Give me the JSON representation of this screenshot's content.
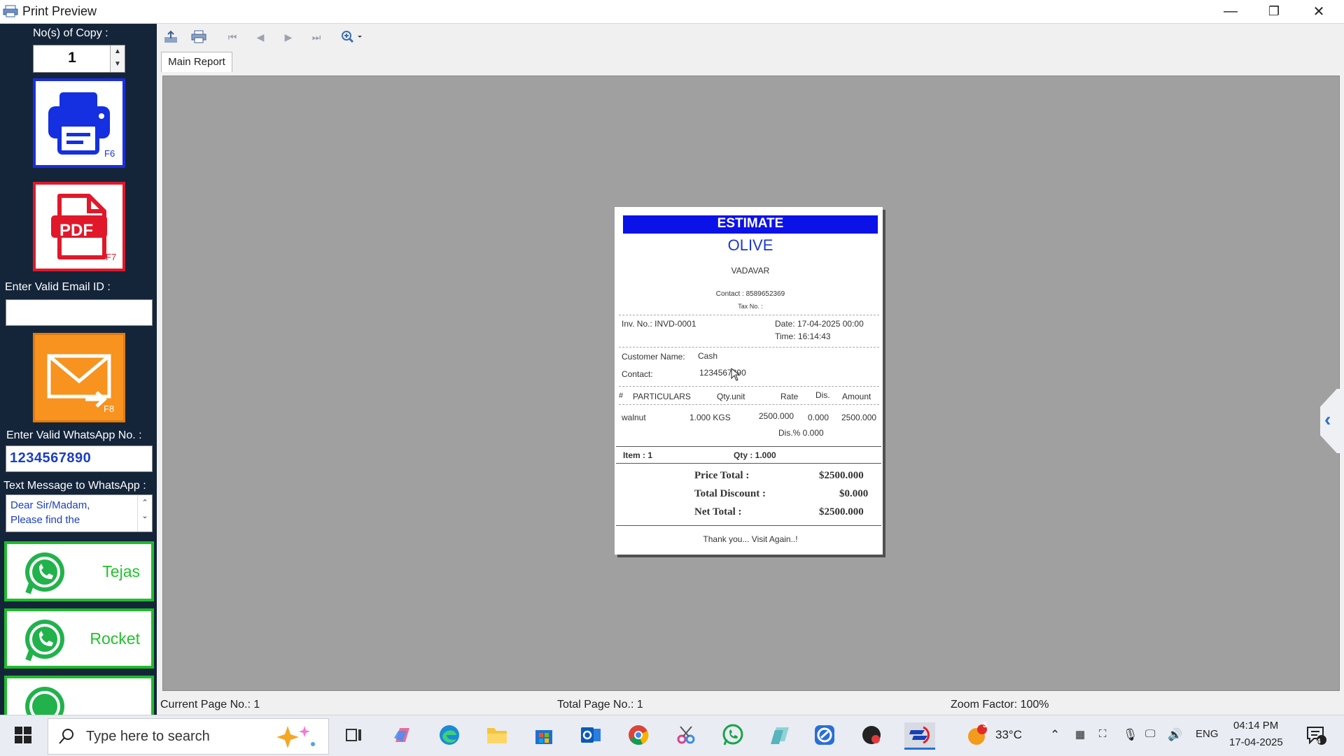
{
  "window": {
    "title": "Print Preview",
    "minimize": "—",
    "restore": "❐",
    "close": "✕"
  },
  "sidebar": {
    "copies_label": "No(s) of Copy :",
    "copies_value": "1",
    "print_key": "F6",
    "pdf_text": "PDF",
    "pdf_key": "F7",
    "email_label": "Enter Valid Email ID :",
    "email_value": "",
    "email_key": "F8",
    "whatsapp_label": "Enter Valid WhatsApp No. :",
    "whatsapp_value": "1234567890",
    "message_label": "Text Message to WhatsApp :",
    "message_line1": "Dear Sir/Madam,",
    "message_line2": "Please find the",
    "whatsapp_buttons": [
      {
        "label": "Tejas"
      },
      {
        "label": "Rocket"
      }
    ]
  },
  "toolbar": {
    "tab": "Main Report"
  },
  "report": {
    "header": "ESTIMATE",
    "company": "OLIVE",
    "address": "VADAVAR",
    "contact": "Contact : 8589652369",
    "tax": "Tax No. :",
    "inv_no": "Inv. No.:  INVD-0001",
    "date": "Date: 17-04-2025 00:00",
    "time": "Time: 16:14:43",
    "customer_label": "Customer Name:",
    "customer_value": "Cash",
    "contact_label": "Contact:",
    "contact_value": "1234567890",
    "columns": {
      "no": "#",
      "particulars": "PARTICULARS",
      "qty": "Qty.unit",
      "rate": "Rate",
      "dis": "Dis.",
      "amount": "Amount"
    },
    "items": [
      {
        "name": "walnut",
        "qty": "1.000 KGS",
        "rate": "2500.000",
        "dis": "0.000",
        "amount": "2500.000",
        "dis_pct": "Dis.% 0.000"
      }
    ],
    "item_count": "Item : 1",
    "qty_total": "Qty : 1.000",
    "price_total_label": "Price Total :",
    "price_total": "$2500.000",
    "discount_label": "Total Discount :",
    "discount": "$0.000",
    "net_label": "Net Total :",
    "net": "$2500.000",
    "footer": "Thank you... Visit Again..!"
  },
  "status": {
    "current_page": "Current Page No.: 1",
    "total_page": "Total Page No.: 1",
    "zoom": "Zoom Factor: 100%"
  },
  "taskbar": {
    "search_placeholder": "Type here to search",
    "temperature": "33°C",
    "weather_badge": "3",
    "language": "ENG",
    "time": "04:14 PM",
    "date": "17-04-2025",
    "notif_count": "4"
  },
  "colors": {
    "sidebar_bg": "#14253a",
    "estimate_blue": "#0a12e8",
    "whatsapp_green": "#1fbb2c"
  }
}
